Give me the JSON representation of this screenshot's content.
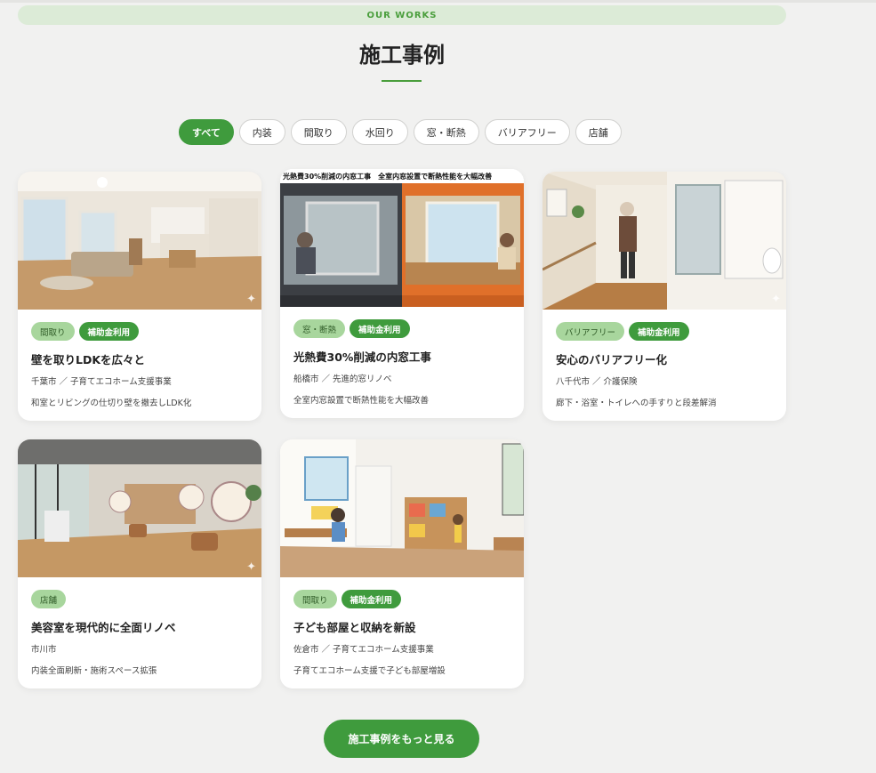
{
  "section": {
    "eyebrow": "OUR WORKS",
    "title": "施工事例"
  },
  "filters": [
    {
      "label": "すべて",
      "active": true
    },
    {
      "label": "内装"
    },
    {
      "label": "間取り"
    },
    {
      "label": "水回り"
    },
    {
      "label": "窓・断熱"
    },
    {
      "label": "バリアフリー"
    },
    {
      "label": "店舗"
    }
  ],
  "cards": [
    {
      "image": "living-room-photo",
      "tags": [
        "間取り",
        "補助金利用"
      ],
      "title": "壁を取りLDKを広々と",
      "meta": "千葉市 ／ 子育てエコホーム支援事業",
      "desc": "和室とリビングの仕切り壁を撤去しLDK化"
    },
    {
      "image": "window-insulation-photo",
      "banner": "光熱費30%削減の内窓工事　全室内窓設置で断熱性能を大幅改善",
      "tags": [
        "窓・断熱",
        "補助金利用"
      ],
      "title": "光熱費30%削減の内窓工事",
      "meta": "船橋市 ／ 先進的窓リノベ",
      "desc": "全室内窓設置で断熱性能を大幅改善"
    },
    {
      "image": "barrier-free-hallway-photo",
      "tags": [
        "バリアフリー",
        "補助金利用"
      ],
      "title": "安心のバリアフリー化",
      "meta": "八千代市 ／ 介護保険",
      "desc": "廊下・浴室・トイレへの手すりと段差解消"
    },
    {
      "image": "salon-interior-photo",
      "tags": [
        "店舗"
      ],
      "title": "美容室を現代的に全面リノベ",
      "meta": "市川市",
      "desc": "内装全面刷新・施術スペース拡張"
    },
    {
      "image": "kids-room-photo",
      "tags": [
        "間取り",
        "補助金利用"
      ],
      "title": "子ども部屋と収納を新設",
      "meta": "佐倉市 ／ 子育てエコホーム支援事業",
      "desc": "子育てエコホーム支援で子ども部屋増設"
    }
  ],
  "more_button": "施工事例をもっと見る",
  "colors": {
    "accent": "#3f9b3d",
    "tag_light": "#a8d69d",
    "eyebrow_bg": "#dcebd7",
    "page_bg": "#f1f1f0"
  }
}
